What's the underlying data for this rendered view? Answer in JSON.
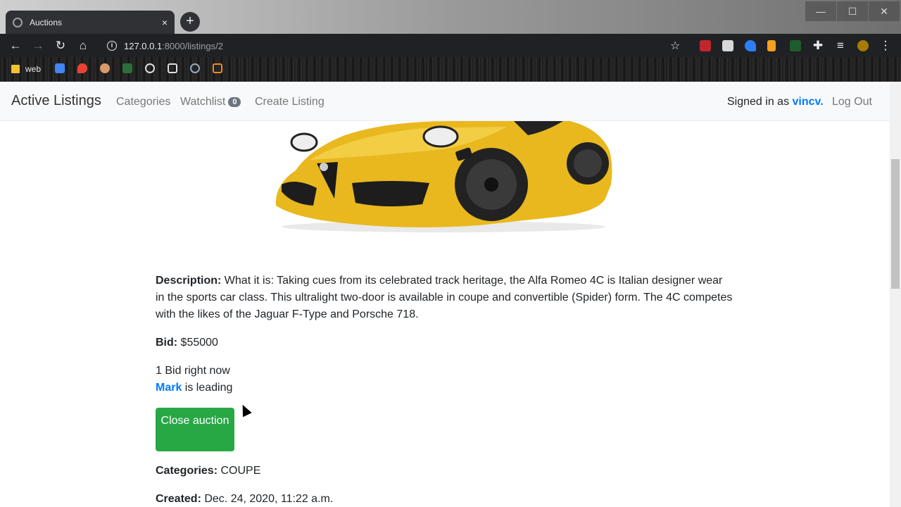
{
  "browser": {
    "tab_title": "Auctions",
    "tab_close": "×",
    "new_tab": "+",
    "url_host": "127.0.0.1",
    "url_path": ":8000/listings/2",
    "bookmark_web": "web",
    "window_controls": [
      "—",
      "☐",
      "✕"
    ]
  },
  "nav": {
    "brand": "Active Listings",
    "categories": "Categories",
    "watchlist": "Watchlist",
    "watchlist_count": "0",
    "create": "Create Listing",
    "signed_prefix": "Signed in as ",
    "username": "vincv",
    "signed_suffix": ".",
    "logout": "Log Out"
  },
  "listing": {
    "description_label": "Description:",
    "description": " What it is: Taking cues from its celebrated track heritage, the Alfa Romeo 4C is Italian designer wear in the sports car class. This ultralight two-door is available in coupe and convertible (Spider) form. The 4C competes with the likes of the Jaguar F-Type and Porsche 718.",
    "bid_label": "Bid:",
    "bid_value": " $55000",
    "bids_count_text": "1 Bid right now",
    "leader": "Mark",
    "leader_suffix": " is leading",
    "close_button": "Close auction",
    "categories_label": "Categories:",
    "categories_value": " COUPE",
    "created_label": "Created:",
    "created_value": " Dec. 24, 2020, 11:22 a.m."
  },
  "colors": {
    "primary": "#007bff",
    "success": "#28a745",
    "car_yellow": "#e8b81e"
  }
}
